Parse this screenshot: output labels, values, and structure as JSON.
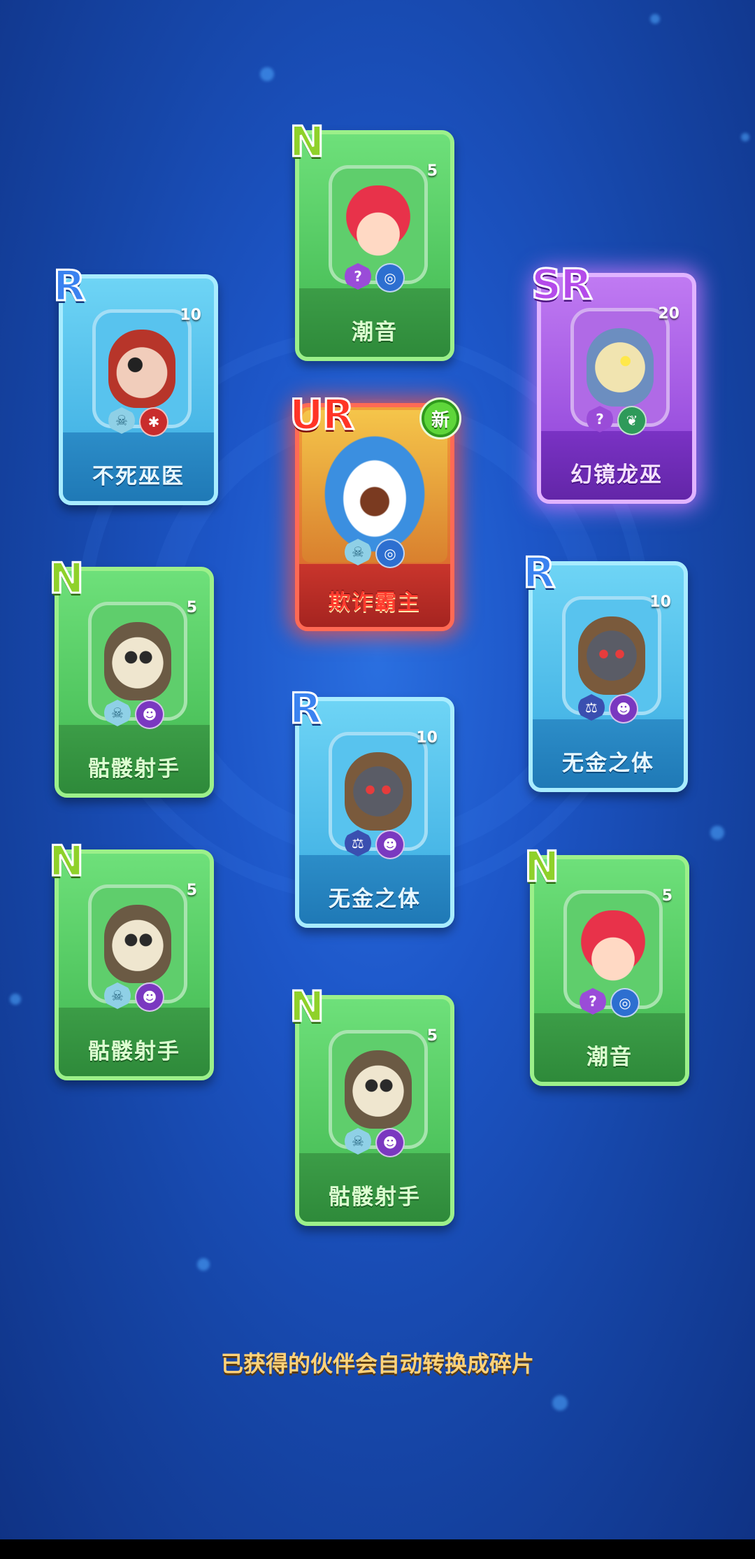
{
  "cards": [
    {
      "id": "top",
      "rarity": "N",
      "name": "潮音",
      "count": "5",
      "art": "mermaid",
      "badges": [
        "mystery-icon",
        "water-icon"
      ]
    },
    {
      "id": "left1",
      "rarity": "R",
      "name": "不死巫医",
      "count": "10",
      "art": "pirate",
      "badges": [
        "crew-icon",
        "beast-icon"
      ]
    },
    {
      "id": "center-ur",
      "rarity": "UR",
      "name": "欺诈霸主",
      "count": "",
      "new_label": "新",
      "art": "shark",
      "badges": [
        "crew-icon",
        "water-icon"
      ]
    },
    {
      "id": "right1",
      "rarity": "SR",
      "name": "幻镜龙巫",
      "count": "20",
      "art": "dragon",
      "badges": [
        "mystery-icon",
        "nature-icon"
      ]
    },
    {
      "id": "left2",
      "rarity": "N",
      "name": "骷髅射手",
      "count": "5",
      "art": "skull",
      "badges": [
        "crew-icon",
        "death-icon"
      ]
    },
    {
      "id": "right2",
      "rarity": "R",
      "name": "无金之体",
      "count": "10",
      "art": "knight",
      "badges": [
        "justice-icon",
        "death-icon"
      ]
    },
    {
      "id": "center2",
      "rarity": "R",
      "name": "无金之体",
      "count": "10",
      "art": "knight",
      "badges": [
        "justice-icon",
        "death-icon"
      ]
    },
    {
      "id": "left3",
      "rarity": "N",
      "name": "骷髅射手",
      "count": "5",
      "art": "skull",
      "badges": [
        "crew-icon",
        "death-icon"
      ]
    },
    {
      "id": "right3",
      "rarity": "N",
      "name": "潮音",
      "count": "5",
      "art": "mermaid",
      "badges": [
        "mystery-icon",
        "water-icon"
      ]
    },
    {
      "id": "bottom",
      "rarity": "N",
      "name": "骷髅射手",
      "count": "5",
      "art": "skull",
      "badges": [
        "crew-icon",
        "death-icon"
      ]
    }
  ],
  "hint": "已获得的伙伴会自动转换成碎片",
  "colors": {
    "background": "#1d56c8",
    "hint": "#ffd27a"
  }
}
